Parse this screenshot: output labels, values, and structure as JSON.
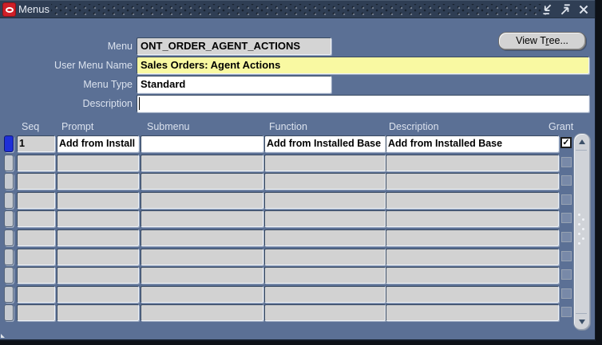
{
  "window": {
    "title": "Menus"
  },
  "form": {
    "fields": [
      {
        "label": "Menu",
        "value": "ONT_ORDER_AGENT_ACTIONS"
      },
      {
        "label": "User Menu Name",
        "value": "Sales Orders: Agent Actions"
      },
      {
        "label": "Menu Type",
        "value": "Standard"
      },
      {
        "label": "Description",
        "value": ""
      }
    ],
    "view_tree_button": {
      "label": "View Tree...",
      "underline_char": "r"
    }
  },
  "table": {
    "columns": [
      "Seq",
      "Prompt",
      "Submenu",
      "Function",
      "Description",
      "Grant"
    ],
    "rows": [
      {
        "seq": "1",
        "prompt": "Add from Install",
        "submenu": "",
        "function": "Add from Installed Base",
        "description": "Add from Installed Base",
        "grant": true,
        "selected": true
      },
      {
        "seq": "",
        "prompt": "",
        "submenu": "",
        "function": "",
        "description": "",
        "grant": false,
        "selected": false
      },
      {
        "seq": "",
        "prompt": "",
        "submenu": "",
        "function": "",
        "description": "",
        "grant": false,
        "selected": false
      },
      {
        "seq": "",
        "prompt": "",
        "submenu": "",
        "function": "",
        "description": "",
        "grant": false,
        "selected": false
      },
      {
        "seq": "",
        "prompt": "",
        "submenu": "",
        "function": "",
        "description": "",
        "grant": false,
        "selected": false
      },
      {
        "seq": "",
        "prompt": "",
        "submenu": "",
        "function": "",
        "description": "",
        "grant": false,
        "selected": false
      },
      {
        "seq": "",
        "prompt": "",
        "submenu": "",
        "function": "",
        "description": "",
        "grant": false,
        "selected": false
      },
      {
        "seq": "",
        "prompt": "",
        "submenu": "",
        "function": "",
        "description": "",
        "grant": false,
        "selected": false
      },
      {
        "seq": "",
        "prompt": "",
        "submenu": "",
        "function": "",
        "description": "",
        "grant": false,
        "selected": false
      },
      {
        "seq": "",
        "prompt": "",
        "submenu": "",
        "function": "",
        "description": "",
        "grant": false,
        "selected": false
      }
    ]
  },
  "colors": {
    "canvas": "#5b7095",
    "titlebar": "#2f3e54",
    "field_highlight_yellow": "#f9f9a2",
    "field_disabled_gray": "#d4d4d4",
    "record_selector_blue": "#1e2fd8",
    "oracle_logo_red": "#cf1f28",
    "outside_background": "#0d1117"
  },
  "check_glyph": "✓"
}
